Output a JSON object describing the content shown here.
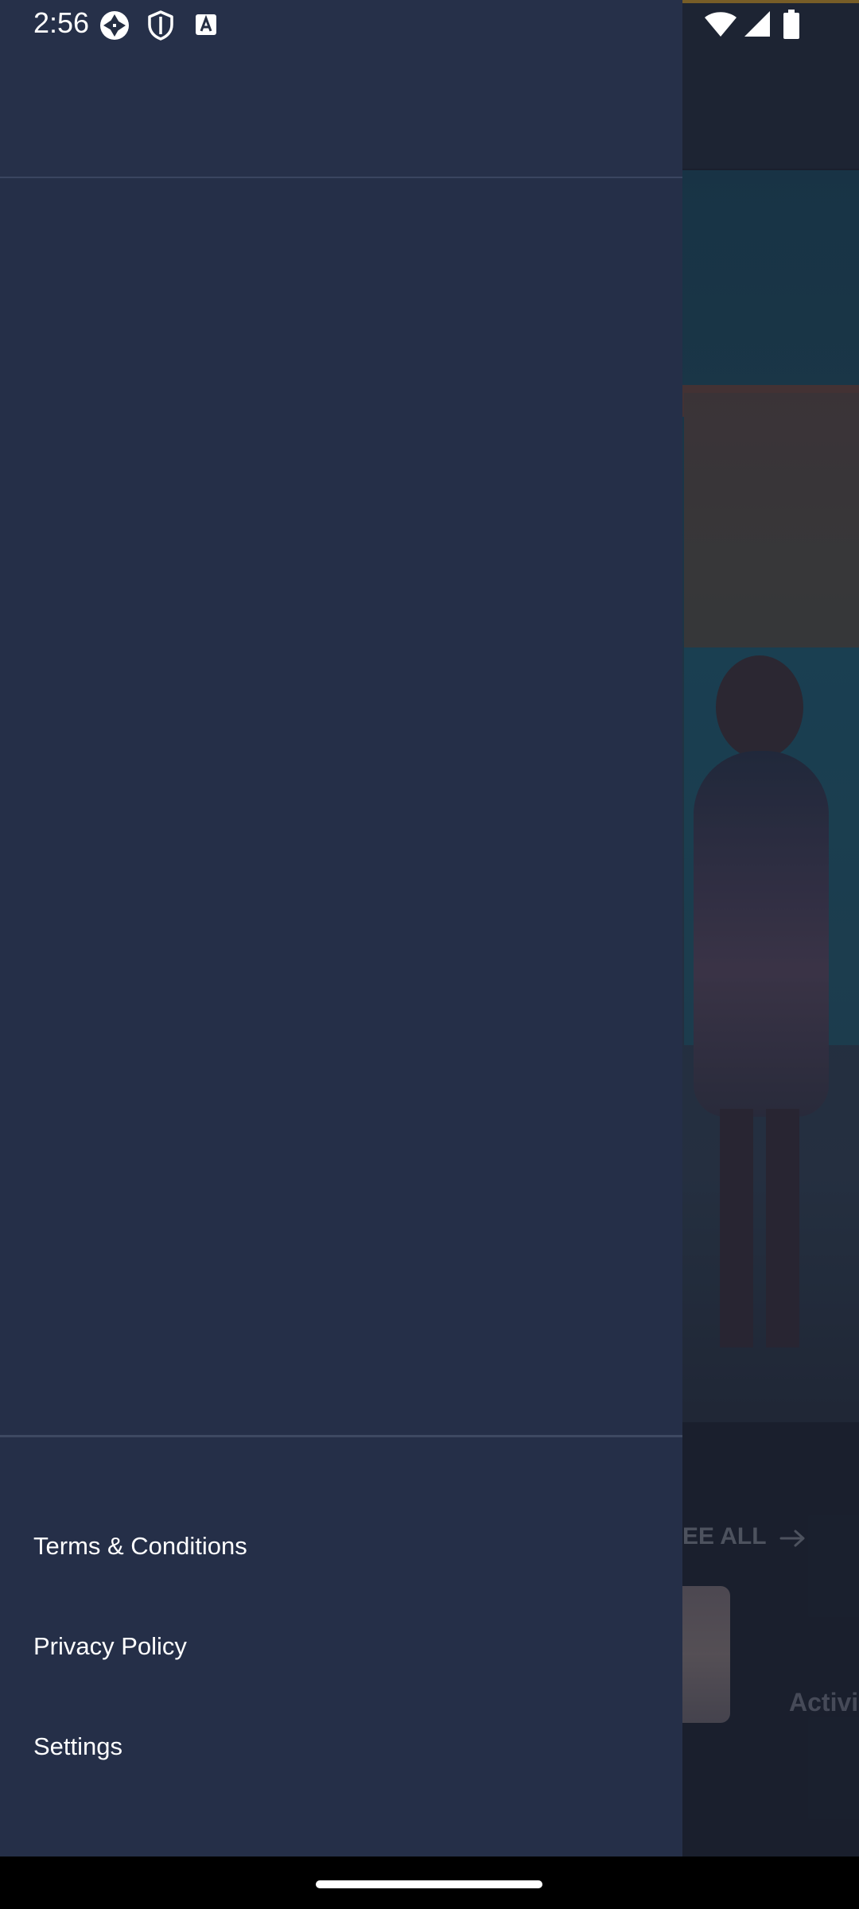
{
  "status_bar": {
    "time": "2:56",
    "icons": [
      "camera-shutter-icon",
      "shield-icon",
      "font-a-icon",
      "wifi-icon",
      "cell-signal-icon",
      "battery-icon"
    ]
  },
  "background": {
    "see_all_label": "SEE ALL",
    "card_label": "Activi",
    "accent_color": "#c9952c"
  },
  "drawer": {
    "items": [
      {
        "label": "Terms & Conditions"
      },
      {
        "label": "Privacy Policy"
      },
      {
        "label": "Settings"
      }
    ],
    "background_color": "#252f48"
  },
  "colors": {
    "drawer_text": "#ffffff",
    "scrim": "rgba(20,24,34,0.45)"
  }
}
